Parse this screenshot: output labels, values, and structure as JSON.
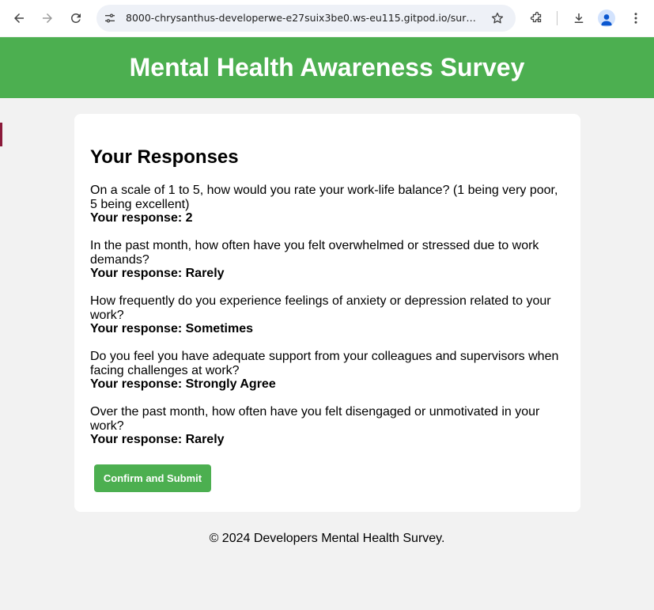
{
  "browser": {
    "url": "8000-chrysanthus-developerwe-e27suix3be0.ws-eu115.gitpod.io/surve..."
  },
  "header": {
    "title": "Mental Health Awareness Survey"
  },
  "card": {
    "title": "Your Responses",
    "responses": [
      {
        "question": "On a scale of 1 to 5, how would you rate your work-life balance? (1 being very poor, 5 being excellent)",
        "answer": "Your response: 2"
      },
      {
        "question": "In the past month, how often have you felt overwhelmed or stressed due to work demands?",
        "answer": "Your response: Rarely"
      },
      {
        "question": "How frequently do you experience feelings of anxiety or depression related to your work?",
        "answer": "Your response: Sometimes"
      },
      {
        "question": "Do you feel you have adequate support from your colleagues and supervisors when facing challenges at work?",
        "answer": "Your response: Strongly Agree"
      },
      {
        "question": "Over the past month, how often have you felt disengaged or unmotivated in your work?",
        "answer": "Your response: Rarely"
      }
    ],
    "submit_label": "Confirm and Submit"
  },
  "footer": {
    "text": "© 2024 Developers Mental Health Survey."
  },
  "colors": {
    "accent": "#4caf50"
  }
}
